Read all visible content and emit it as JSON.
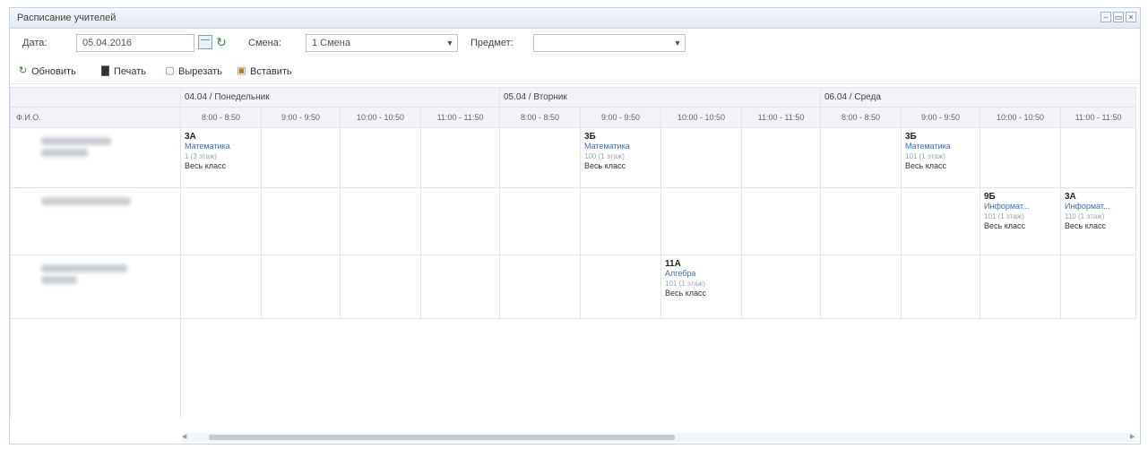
{
  "window": {
    "title": "Расписание учителей",
    "controls": [
      "–",
      "▭",
      "×"
    ]
  },
  "filters": {
    "date_label": "Дата:",
    "date_value": "05.04.2016",
    "shift_label": "Смена:",
    "shift_value": "1 Смена",
    "subject_label": "Предмет:",
    "subject_value": ""
  },
  "toolbar": {
    "refresh_label": "Обновить",
    "print_label": "Печать",
    "cut_label": "Вырезать",
    "paste_label": "Вставить"
  },
  "grid": {
    "fio_header": "Ф.И.О.",
    "days": [
      "04.04 / Понедельник",
      "05.04 / Вторник",
      "06.04 / Среда"
    ],
    "times": [
      "8:00 - 8:50",
      "9:00 - 9:50",
      "10:00 - 10:50",
      "11:00 - 11:50"
    ],
    "lessons": {
      "r1c1": {
        "cls": "3А",
        "subj": "Математика",
        "room": "1 (3 этаж)",
        "group": "Весь класс"
      },
      "r1c6": {
        "cls": "3Б",
        "subj": "Математика",
        "room": "100 (1 этаж)",
        "group": "Весь класс"
      },
      "r1c10": {
        "cls": "3Б",
        "subj": "Математика",
        "room": "101 (1 этаж)",
        "group": "Весь класс"
      },
      "r2c11": {
        "cls": "9Б",
        "subj": "Информат...",
        "room": "101 (1 этаж)",
        "group": "Весь класс"
      },
      "r2c12": {
        "cls": "3А",
        "subj": "Информат...",
        "room": "110 (1 этаж)",
        "group": "Весь класс"
      },
      "r3c7": {
        "cls": "11А",
        "subj": "Алгебра",
        "room": "101 (1 этаж)",
        "group": "Весь класс"
      }
    }
  }
}
